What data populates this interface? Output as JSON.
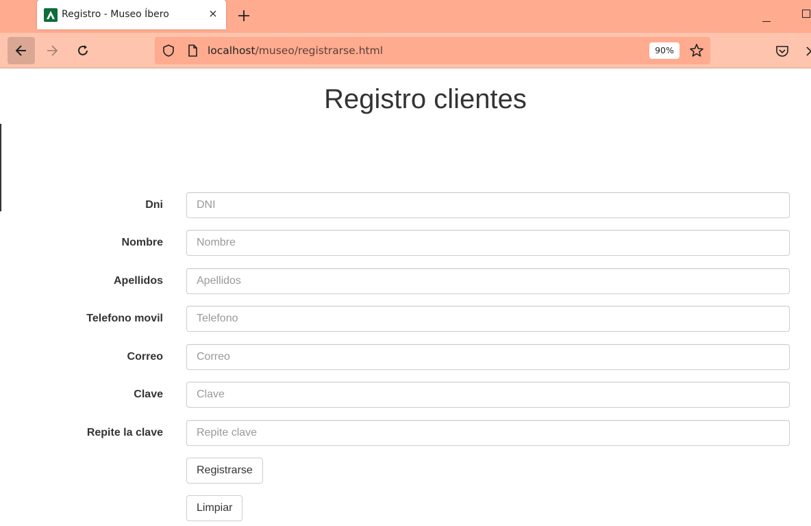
{
  "browser": {
    "tab_title": "Registro - Museo Íbero",
    "url_host": "localhost",
    "url_path": "/museo/registrarse.html",
    "zoom": "90%"
  },
  "page": {
    "title": "Registro clientes"
  },
  "form": {
    "fields": [
      {
        "label": "Dni",
        "placeholder": "DNI"
      },
      {
        "label": "Nombre",
        "placeholder": "Nombre"
      },
      {
        "label": "Apellidos",
        "placeholder": "Apellidos"
      },
      {
        "label": "Telefono movil",
        "placeholder": "Telefono"
      },
      {
        "label": "Correo",
        "placeholder": "Correo"
      },
      {
        "label": "Clave",
        "placeholder": "Clave"
      },
      {
        "label": "Repite la clave",
        "placeholder": "Repite clave"
      }
    ],
    "submit_label": "Registrarse",
    "reset_label": "Limpiar"
  },
  "colors": {
    "tabstrip": "#ffab8f",
    "navbar": "#ffc4ad",
    "favicon": "#0f6d3a"
  }
}
